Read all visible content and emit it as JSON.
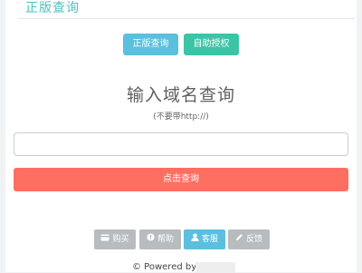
{
  "header": {
    "title": "正版查询"
  },
  "actions": {
    "query_label": "正版查询",
    "auth_label": "自助授权"
  },
  "main": {
    "title": "输入域名查询",
    "hint": "(不要带http://)",
    "input_value": "",
    "input_placeholder": "",
    "submit_label": "点击查询"
  },
  "footer": {
    "buttons": [
      {
        "icon": "card-icon",
        "label": "购买"
      },
      {
        "icon": "help-icon",
        "label": "帮助"
      },
      {
        "icon": "user-icon",
        "label": "客服"
      },
      {
        "icon": "pencil-icon",
        "label": "反馈"
      }
    ],
    "powered": "© Powered by"
  },
  "colors": {
    "accent": "#4cc0c2",
    "info": "#5bc0de",
    "success": "#3cc4a6",
    "danger": "#ff6f61",
    "muted": "#b8bcc1"
  }
}
